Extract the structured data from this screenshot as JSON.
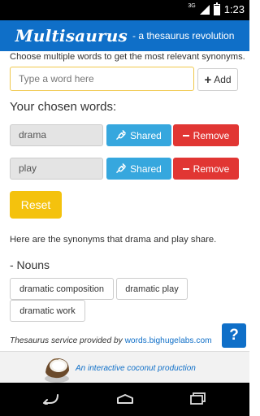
{
  "status_bar": {
    "network": "3G",
    "time": "1:23"
  },
  "header": {
    "title": "Multisaurus",
    "tagline": "- a thesaurus revolution"
  },
  "intro_text": "Choose multiple words to get the most relevant synonyms.",
  "search": {
    "placeholder": "Type a word here",
    "value": "",
    "add_label": "Add"
  },
  "chosen": {
    "heading": "Your chosen words:",
    "words": [
      {
        "word": "drama",
        "shared_label": "Shared",
        "remove_label": "Remove"
      },
      {
        "word": "play",
        "shared_label": "Shared",
        "remove_label": "Remove"
      }
    ]
  },
  "reset_label": "Reset",
  "share_text": "Here are the synonyms that drama and play share.",
  "results": {
    "heading": "- Nouns",
    "synonyms": [
      "dramatic composition",
      "dramatic play",
      "dramatic work"
    ]
  },
  "credit": {
    "text": "Thesaurus service provided by ",
    "link": "words.bighugelabs.com"
  },
  "help_label": "?",
  "footer": {
    "text": "An interactive coconut production"
  },
  "colors": {
    "brand_blue": "#0f6fc8",
    "shared_blue": "#36a7de",
    "remove_red": "#e13633",
    "reset_yellow": "#f4c20d"
  },
  "icons": {
    "add": "plus-icon",
    "shared": "plug-icon",
    "remove": "minus-icon",
    "help": "question-icon",
    "footer_logo": "coconut-logo",
    "nav": [
      "back-icon",
      "home-icon",
      "recents-icon"
    ]
  }
}
